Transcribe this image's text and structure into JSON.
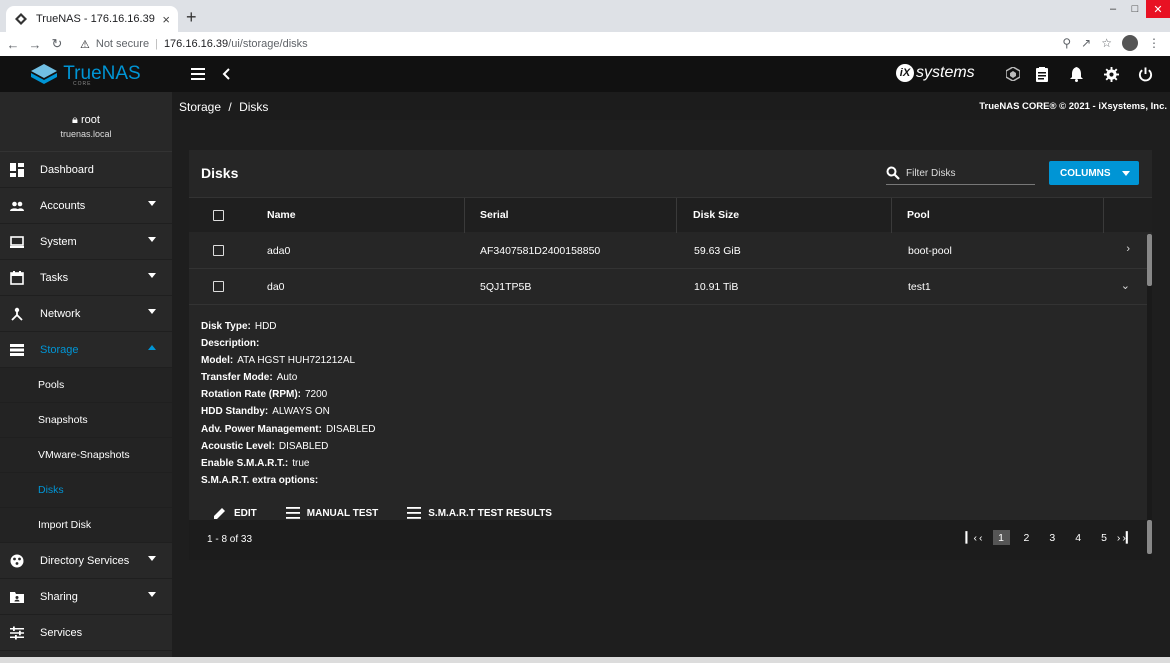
{
  "browser": {
    "tab_title": "TrueNAS - 176.16.16.39",
    "tab_close": "×",
    "new_tab": "+",
    "security": "Not secure",
    "url_host": "176.16.16.39",
    "url_path": "/ui/storage/disks"
  },
  "header": {
    "brand": "TrueNAS",
    "brand_sub": "CORE",
    "vendor": "systems"
  },
  "user": {
    "name": "root",
    "host": "truenas.local"
  },
  "sidebar": {
    "items": [
      {
        "label": "Dashboard"
      },
      {
        "label": "Accounts"
      },
      {
        "label": "System"
      },
      {
        "label": "Tasks"
      },
      {
        "label": "Network"
      },
      {
        "label": "Storage"
      },
      {
        "label": "Directory Services"
      },
      {
        "label": "Sharing"
      },
      {
        "label": "Services"
      }
    ],
    "storage_sub": [
      {
        "label": "Pools"
      },
      {
        "label": "Snapshots"
      },
      {
        "label": "VMware-Snapshots"
      },
      {
        "label": "Disks"
      },
      {
        "label": "Import Disk"
      }
    ]
  },
  "breadcrumb": {
    "parent": "Storage",
    "separator": "/",
    "current": "Disks"
  },
  "copyright": "TrueNAS CORE® © 2021 - iXsystems, Inc.",
  "card": {
    "title": "Disks",
    "filter_placeholder": "Filter Disks",
    "columns_button": "COLUMNS"
  },
  "table": {
    "headers": [
      "Name",
      "Serial",
      "Disk Size",
      "Pool"
    ],
    "rows": [
      {
        "name": "ada0",
        "serial": "AF3407581D2400158850",
        "size": "59.63 GiB",
        "pool": "boot-pool"
      },
      {
        "name": "da0",
        "serial": "5QJ1TP5B",
        "size": "10.91 TiB",
        "pool": "test1"
      }
    ]
  },
  "detail": [
    {
      "label": "Disk Type:",
      "value": "HDD"
    },
    {
      "label": "Description:",
      "value": ""
    },
    {
      "label": "Model:",
      "value": "ATA HGST HUH721212AL"
    },
    {
      "label": "Transfer Mode:",
      "value": "Auto"
    },
    {
      "label": "Rotation Rate (RPM):",
      "value": "7200"
    },
    {
      "label": "HDD Standby:",
      "value": "ALWAYS ON"
    },
    {
      "label": "Adv. Power Management:",
      "value": "DISABLED"
    },
    {
      "label": "Acoustic Level:",
      "value": "DISABLED"
    },
    {
      "label": "Enable S.M.A.R.T.:",
      "value": "true"
    },
    {
      "label": "S.M.A.R.T. extra options:",
      "value": ""
    }
  ],
  "actions": {
    "edit": "EDIT",
    "manual_test": "MANUAL TEST",
    "smart_results": "S.M.A.R.T TEST RESULTS"
  },
  "footer": {
    "range": "1 - 8 of 33",
    "pages": [
      "1",
      "2",
      "3",
      "4",
      "5"
    ]
  },
  "colors": {
    "accent": "#0095d5",
    "background": "#1e1e1e",
    "sidebar": "#282828",
    "topbar": "#111111"
  }
}
